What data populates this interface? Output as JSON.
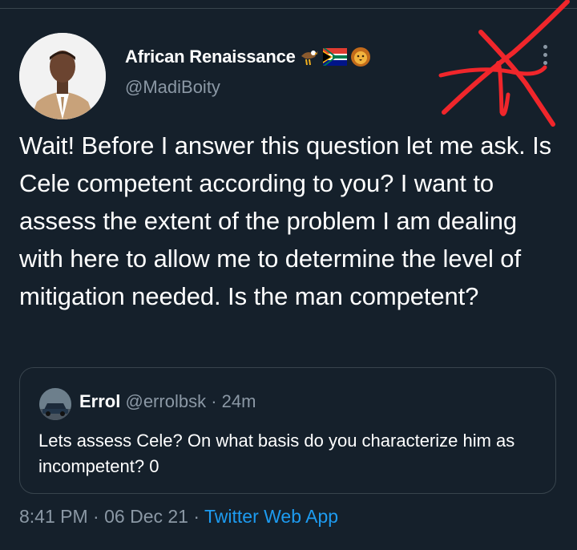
{
  "tweet": {
    "author": {
      "display_name": "African Renaissance",
      "handle": "@MadiBoity",
      "emojis": [
        "eagle-emoji",
        "south-africa-flag-emoji",
        "lion-emoji"
      ]
    },
    "text": "Wait! Before I answer this question let me ask. Is Cele competent according to you? I want to assess the extent of the problem I am dealing with here to allow me to determine the level of mitigation needed. Is the man competent?",
    "quoted": {
      "display_name": "Errol",
      "handle": "@errolbsk",
      "separator": "·",
      "time": "24m",
      "text": "Lets assess Cele? On what basis do you characterize him as incompetent? 0"
    },
    "time": "8:41 PM",
    "separator": "·",
    "date": "06 Dec 21",
    "source": "Twitter Web App"
  },
  "colors": {
    "background": "#15202b",
    "text": "#ffffff",
    "muted": "#8b98a5",
    "accent": "#1d9bf0",
    "border": "#38444d",
    "scribble": "#f0262b"
  }
}
